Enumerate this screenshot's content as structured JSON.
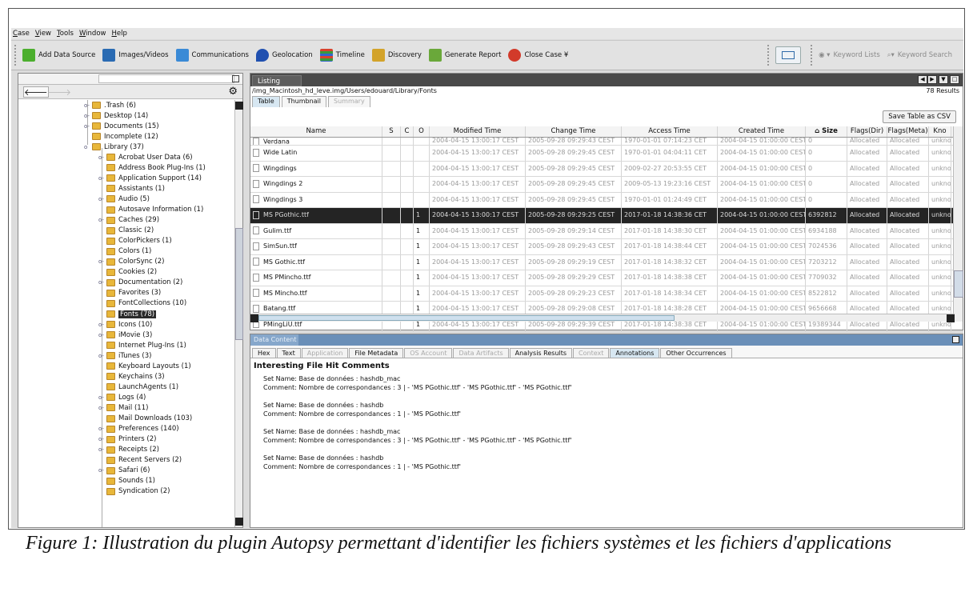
{
  "menu": [
    "Case",
    "View",
    "Tools",
    "Window",
    "Help"
  ],
  "toolbar": {
    "buttons": [
      {
        "label": "Add Data Source",
        "icon": "plus-icon",
        "color": "#4caf2e"
      },
      {
        "label": "Images/Videos",
        "icon": "film-icon",
        "color": "#2a6bb3"
      },
      {
        "label": "Communications",
        "icon": "communications-icon",
        "color": "#3a8ad6"
      },
      {
        "label": "Geolocation",
        "icon": "map-pin-icon",
        "color": "#2050b0"
      },
      {
        "label": "Timeline",
        "icon": "timeline-icon",
        "color": "#d8422d"
      },
      {
        "label": "Discovery",
        "icon": "discovery-icon",
        "color": "#d3a32a"
      },
      {
        "label": "Generate Report",
        "icon": "report-icon",
        "color": "#6aa83a"
      },
      {
        "label": "Close Case",
        "icon": "close-case-icon",
        "color": "#d23a2a"
      }
    ],
    "close_case_caret": "¥",
    "keyword_lists": "Keyword Lists",
    "keyword_search": "Keyword Search"
  },
  "tree": {
    "items": [
      {
        "label": ".Trash (6)",
        "toggle": "o-"
      },
      {
        "label": "Desktop (14)",
        "toggle": "o-"
      },
      {
        "label": "Documents (15)",
        "toggle": "o-"
      },
      {
        "label": "Incomplete (12)",
        "toggle": ""
      },
      {
        "label": "Library (37)",
        "toggle": "o"
      },
      {
        "label": "Acrobat User Data (6)",
        "toggle": "o-"
      },
      {
        "label": "Address Book Plug-Ins (1)",
        "toggle": ""
      },
      {
        "label": "Application Support (14)",
        "toggle": "o-"
      },
      {
        "label": "Assistants (1)",
        "toggle": ""
      },
      {
        "label": "Audio (5)",
        "toggle": "o-"
      },
      {
        "label": "Autosave Information (1)",
        "toggle": ""
      },
      {
        "label": "Caches (29)",
        "toggle": "o-"
      },
      {
        "label": "Classic (2)",
        "toggle": ""
      },
      {
        "label": "ColorPickers (1)",
        "toggle": ""
      },
      {
        "label": "Colors (1)",
        "toggle": ""
      },
      {
        "label": "ColorSync (2)",
        "toggle": "o-"
      },
      {
        "label": "Cookies (2)",
        "toggle": ""
      },
      {
        "label": "Documentation (2)",
        "toggle": "o-"
      },
      {
        "label": "Favorites (3)",
        "toggle": ""
      },
      {
        "label": "FontCollections (10)",
        "toggle": ""
      },
      {
        "label": "Fonts (78)",
        "toggle": "",
        "selected": true
      },
      {
        "label": "Icons (10)",
        "toggle": "o-"
      },
      {
        "label": "iMovie (3)",
        "toggle": "o-"
      },
      {
        "label": "Internet Plug-Ins (1)",
        "toggle": ""
      },
      {
        "label": "iTunes (3)",
        "toggle": "o-"
      },
      {
        "label": "Keyboard Layouts (1)",
        "toggle": ""
      },
      {
        "label": "Keychains (3)",
        "toggle": ""
      },
      {
        "label": "LaunchAgents (1)",
        "toggle": ""
      },
      {
        "label": "Logs (4)",
        "toggle": "o-"
      },
      {
        "label": "Mail (11)",
        "toggle": "o-"
      },
      {
        "label": "Mail Downloads (103)",
        "toggle": ""
      },
      {
        "label": "Preferences (140)",
        "toggle": "o-"
      },
      {
        "label": "Printers (2)",
        "toggle": "o-"
      },
      {
        "label": "Receipts (2)",
        "toggle": "o-"
      },
      {
        "label": "Recent Servers (2)",
        "toggle": ""
      },
      {
        "label": "Safari (6)",
        "toggle": "o-"
      },
      {
        "label": "Sounds (1)",
        "toggle": ""
      },
      {
        "label": "Syndication (2)",
        "toggle": ""
      }
    ]
  },
  "listing": {
    "tab": "Listing",
    "path": "/img_Macintosh_hd_leve.img/Users/edouard/Library/Fonts",
    "count": "78 Results",
    "subtabs": [
      {
        "label": "Table",
        "state": "act"
      },
      {
        "label": "Thumbnail",
        "state": ""
      },
      {
        "label": "Summary",
        "state": "dim"
      }
    ],
    "csv": "Save Table as CSV",
    "columns": [
      "Name",
      "S",
      "C",
      "O",
      "Modified Time",
      "Change Time",
      "Access Time",
      "Created Time",
      "⌂ Size",
      "Flags(Dir)",
      "Flags(Meta)",
      "Kno"
    ],
    "rows": [
      {
        "name": "Verdana",
        "o": "",
        "m": "2004-04-15 13:00:17 CEST",
        "c": "2005-09-28 09:29:43 CEST",
        "a": "1970-01-01 07:14:23 CET",
        "cr": "2004-04-15 01:00:00 CEST",
        "size": "0",
        "fd": "Allocated",
        "fm": "Allocated",
        "k": "unkno"
      },
      {
        "name": "Wide Latin",
        "o": "",
        "m": "2004-04-15 13:00:17 CEST",
        "c": "2005-09-28 09:29:45 CEST",
        "a": "1970-01-01 04:04:11 CET",
        "cr": "2004-04-15 01:00:00 CEST",
        "size": "0",
        "fd": "Allocated",
        "fm": "Allocated",
        "k": "unkno"
      },
      {
        "name": "Wingdings",
        "o": "",
        "m": "2004-04-15 13:00:17 CEST",
        "c": "2005-09-28 09:29:45 CEST",
        "a": "2009-02-27 20:53:55 CET",
        "cr": "2004-04-15 01:00:00 CEST",
        "size": "0",
        "fd": "Allocated",
        "fm": "Allocated",
        "k": "unkno"
      },
      {
        "name": "Wingdings 2",
        "o": "",
        "m": "2004-04-15 13:00:17 CEST",
        "c": "2005-09-28 09:29:45 CEST",
        "a": "2009-05-13 19:23:16 CEST",
        "cr": "2004-04-15 01:00:00 CEST",
        "size": "0",
        "fd": "Allocated",
        "fm": "Allocated",
        "k": "unkno"
      },
      {
        "name": "Wingdings 3",
        "o": "",
        "m": "2004-04-15 13:00:17 CEST",
        "c": "2005-09-28 09:29:45 CEST",
        "a": "1970-01-01 01:24:49 CET",
        "cr": "2004-04-15 01:00:00 CEST",
        "size": "0",
        "fd": "Allocated",
        "fm": "Allocated",
        "k": "unkno"
      },
      {
        "name": "MS PGothic.ttf",
        "o": "1",
        "m": "2004-04-15 13:00:17 CEST",
        "c": "2005-09-28 09:29:25 CEST",
        "a": "2017-01-18 14:38:36 CET",
        "cr": "2004-04-15 01:00:00 CEST",
        "size": "6392812",
        "fd": "Allocated",
        "fm": "Allocated",
        "k": "unkno",
        "selected": true
      },
      {
        "name": "Gulim.ttf",
        "o": "1",
        "m": "2004-04-15 13:00:17 CEST",
        "c": "2005-09-28 09:29:14 CEST",
        "a": "2017-01-18 14:38:30 CET",
        "cr": "2004-04-15 01:00:00 CEST",
        "size": "6934188",
        "fd": "Allocated",
        "fm": "Allocated",
        "k": "unkno"
      },
      {
        "name": "SimSun.ttf",
        "o": "1",
        "m": "2004-04-15 13:00:17 CEST",
        "c": "2005-09-28 09:29:43 CEST",
        "a": "2017-01-18 14:38:44 CET",
        "cr": "2004-04-15 01:00:00 CEST",
        "size": "7024536",
        "fd": "Allocated",
        "fm": "Allocated",
        "k": "unkno"
      },
      {
        "name": "MS Gothic.ttf",
        "o": "1",
        "m": "2004-04-15 13:00:17 CEST",
        "c": "2005-09-28 09:29:19 CEST",
        "a": "2017-01-18 14:38:32 CET",
        "cr": "2004-04-15 01:00:00 CEST",
        "size": "7203212",
        "fd": "Allocated",
        "fm": "Allocated",
        "k": "unkno"
      },
      {
        "name": "MS PMincho.ttf",
        "o": "1",
        "m": "2004-04-15 13:00:17 CEST",
        "c": "2005-09-28 09:29:29 CEST",
        "a": "2017-01-18 14:38:38 CET",
        "cr": "2004-04-15 01:00:00 CEST",
        "size": "7709032",
        "fd": "Allocated",
        "fm": "Allocated",
        "k": "unkno"
      },
      {
        "name": "MS Mincho.ttf",
        "o": "1",
        "m": "2004-04-15 13:00:17 CEST",
        "c": "2005-09-28 09:29:23 CEST",
        "a": "2017-01-18 14:38:34 CET",
        "cr": "2004-04-15 01:00:00 CEST",
        "size": "8522812",
        "fd": "Allocated",
        "fm": "Allocated",
        "k": "unkno"
      },
      {
        "name": "Batang.ttf",
        "o": "1",
        "m": "2004-04-15 13:00:17 CEST",
        "c": "2005-09-28 09:29:08 CEST",
        "a": "2017-01-18 14:38:28 CET",
        "cr": "2004-04-15 01:00:00 CEST",
        "size": "9656668",
        "fd": "Allocated",
        "fm": "Allocated",
        "k": "unkno"
      },
      {
        "name": "PMingLiU.ttf",
        "o": "1",
        "m": "2004-04-15 13:00:17 CEST",
        "c": "2005-09-28 09:29:39 CEST",
        "a": "2017-01-18 14:38:38 CET",
        "cr": "2004-04-15 01:00:00 CEST",
        "size": "19389344",
        "fd": "Allocated",
        "fm": "Allocated",
        "k": "unkno"
      }
    ]
  },
  "data_content": {
    "tab": "Data Content",
    "tabs": [
      {
        "label": "Hex",
        "state": ""
      },
      {
        "label": "Text",
        "state": ""
      },
      {
        "label": "Application",
        "state": "dim"
      },
      {
        "label": "File Metadata",
        "state": ""
      },
      {
        "label": "OS Account",
        "state": "dim"
      },
      {
        "label": "Data Artifacts",
        "state": "dim"
      },
      {
        "label": "Analysis Results",
        "state": ""
      },
      {
        "label": "Context",
        "state": "dim"
      },
      {
        "label": "Annotations",
        "state": "act"
      },
      {
        "label": "Other Occurrences",
        "state": ""
      }
    ],
    "heading": "Interesting File Hit Comments",
    "comments": [
      {
        "set": "Set Name:  Base de données : hashdb_mac",
        "comment": "Comment:  Nombre de correspondances : 3 | - 'MS PGothic.ttf' - 'MS PGothic.ttf' - 'MS PGothic.ttf'"
      },
      {
        "set": "Set Name:  Base de données : hashdb",
        "comment": "Comment:  Nombre de correspondances : 1 | - 'MS PGothic.ttf'"
      },
      {
        "set": "Set Name:  Base de données : hashdb_mac",
        "comment": "Comment:  Nombre de correspondances : 3 | - 'MS PGothic.ttf' - 'MS PGothic.ttf' - 'MS PGothic.ttf'"
      },
      {
        "set": "Set Name:  Base de données : hashdb",
        "comment": "Comment:  Nombre de correspondances : 1 | - 'MS PGothic.ttf'"
      }
    ]
  },
  "caption": "Figure 1: Illustration du plugin Autopsy permettant d'identifier les fichiers systèmes et les fichiers d'applications"
}
